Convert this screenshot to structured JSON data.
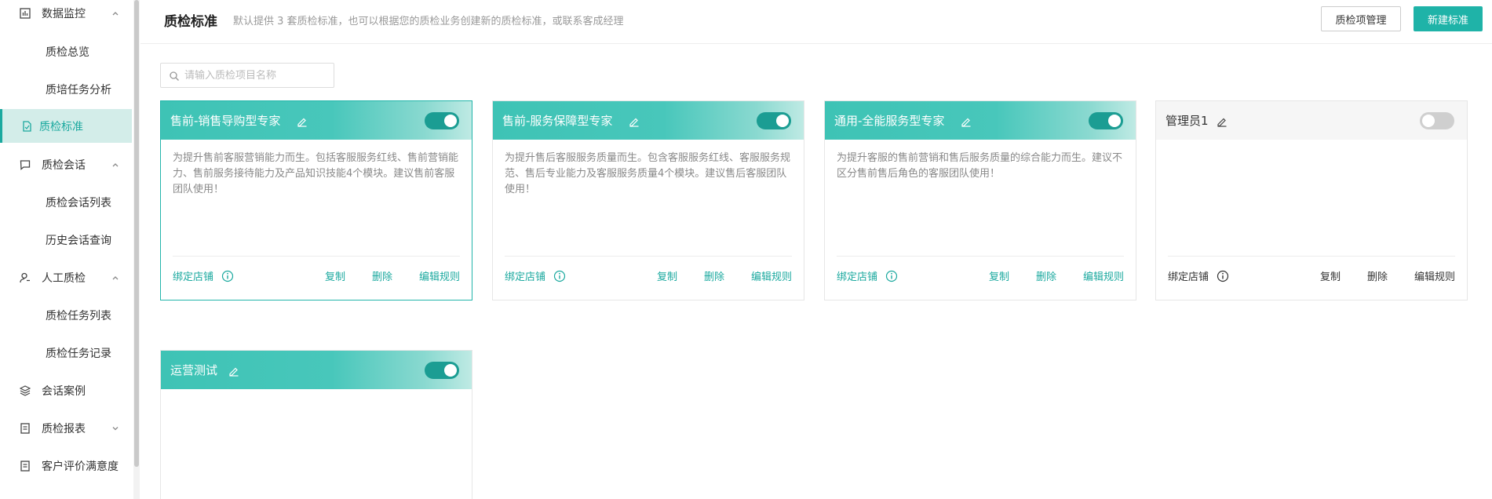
{
  "sidebar": {
    "items": [
      {
        "label": "数据监控",
        "icon": "bar-chart-icon",
        "expanded": true
      },
      {
        "label": "质检总览"
      },
      {
        "label": "质培任务分析"
      },
      {
        "label": "质检标准",
        "icon": "document-check-icon",
        "active": true
      },
      {
        "label": "质检会话",
        "icon": "chat-bubble-icon",
        "expanded": true
      },
      {
        "label": "质检会话列表"
      },
      {
        "label": "历史会话查询"
      },
      {
        "label": "人工质检",
        "icon": "user-icon",
        "expanded": true
      },
      {
        "label": "质检任务列表"
      },
      {
        "label": "质检任务记录"
      },
      {
        "label": "会话案例",
        "icon": "layers-icon"
      },
      {
        "label": "质检报表",
        "icon": "report-icon",
        "expanded": false
      },
      {
        "label": "客户评价满意度",
        "icon": "report-icon"
      }
    ]
  },
  "header": {
    "title": "质检标准",
    "description": "默认提供 3 套质检标准，也可以根据您的质检业务创建新的质检标准，或联系客成经理",
    "manage_button": "质检项管理",
    "new_button": "新建标准"
  },
  "search": {
    "placeholder": "请输入质检项目名称",
    "value": ""
  },
  "cards": [
    {
      "title": "售前-销售导购型专家",
      "enabled": true,
      "description": "为提升售前客服营销能力而生。包括客服服务红线、售前营销能力、售前服务接待能力及产品知识技能4个模块。建议售前客服团队使用！",
      "bind_store": "绑定店铺",
      "copy": "复制",
      "delete": "删除",
      "edit_rules": "编辑规则"
    },
    {
      "title": "售前-服务保障型专家",
      "enabled": true,
      "description": "为提升售后客服服务质量而生。包含客服服务红线、客服服务规范、售后专业能力及客服服务质量4个模块。建议售后客服团队使用！",
      "bind_store": "绑定店铺",
      "copy": "复制",
      "delete": "删除",
      "edit_rules": "编辑规则"
    },
    {
      "title": "通用-全能服务型专家",
      "enabled": true,
      "description": "为提升客服的售前营销和售后服务质量的综合能力而生。建议不区分售前售后角色的客服团队使用！",
      "bind_store": "绑定店铺",
      "copy": "复制",
      "delete": "删除",
      "edit_rules": "编辑规则"
    },
    {
      "title": "管理员1",
      "enabled": false,
      "description": "",
      "bind_store": "绑定店铺",
      "copy": "复制",
      "delete": "删除",
      "edit_rules": "编辑规则"
    },
    {
      "title": "运营测试",
      "enabled": true,
      "description": ""
    }
  ],
  "colors": {
    "accent": "#1fb3a8",
    "active_bg": "#d3ede9",
    "link": "#1ba99f"
  }
}
